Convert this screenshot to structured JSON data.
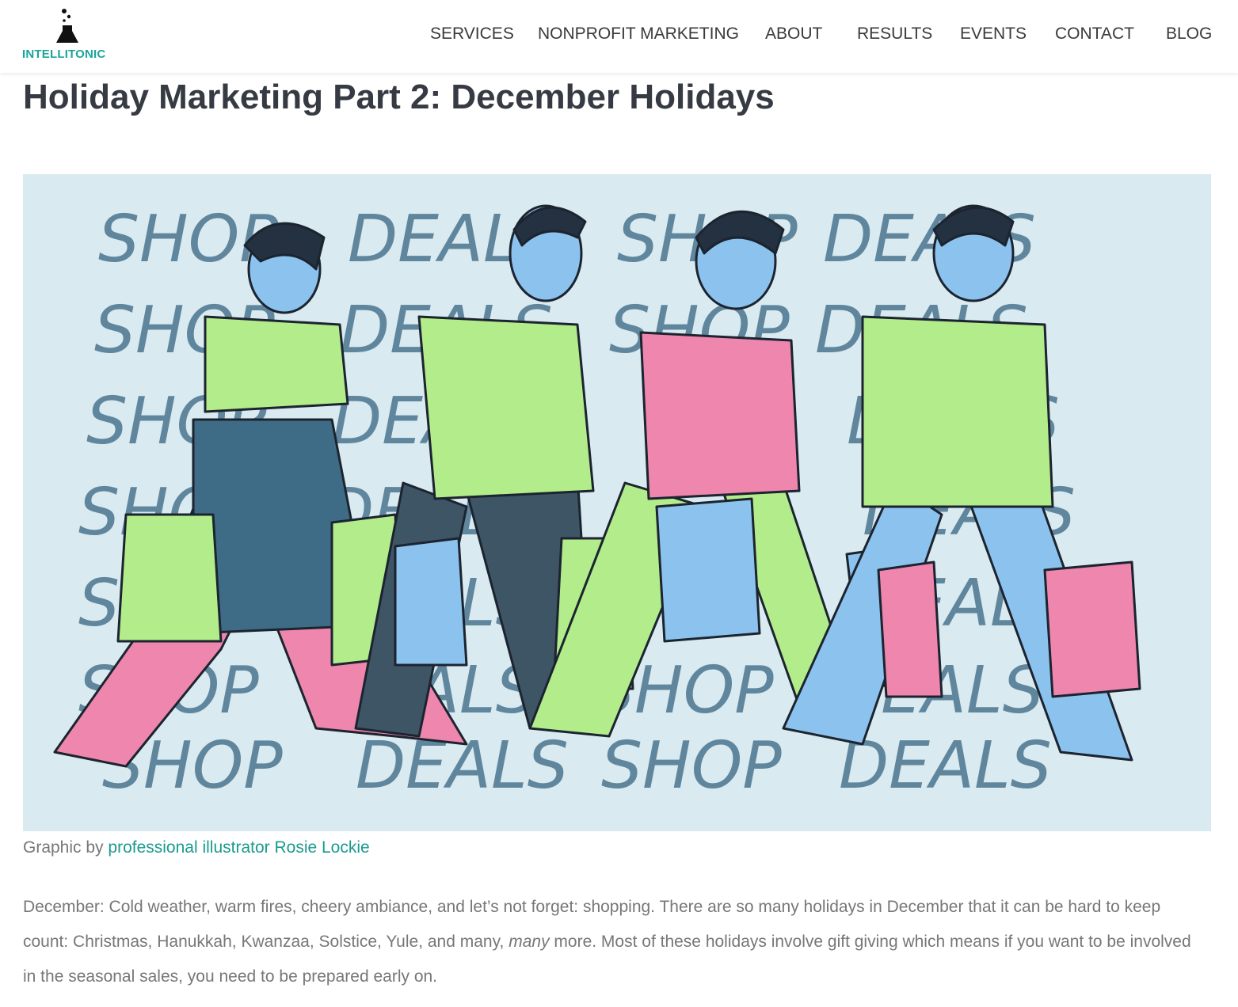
{
  "header": {
    "logo_text": "INTELLITONIC",
    "nav": [
      "SERVICES",
      "NONPROFIT MARKETING",
      "ABOUT",
      "RESULTS",
      "EVENTS",
      "CONTACT",
      "BLOG"
    ]
  },
  "post": {
    "title": "Holiday Marketing Part 2: December Holidays",
    "hero_words": [
      "SHOP",
      "DEALS"
    ],
    "caption_prefix": "Graphic by ",
    "caption_link": "professional illustrator Rosie Lockie",
    "body_part1": "December: Cold weather, warm fires, cheery ambiance, and let’s not forget: shopping. There are so many holidays in December that it can be hard to keep count: Christmas, Hanukkah, Kwanzaa, Solstice, Yule, and many, ",
    "body_emphasis": "many",
    "body_part2": " more. Most of these holidays involve gift giving which means if you want to be involved in the seasonal sales, you need to be prepared early on."
  },
  "colors": {
    "brand": "#1aa59a",
    "link": "#1a9b8f",
    "title": "#363a43",
    "hero_bg": "#d9eaf0",
    "lime": "#b3ec8a",
    "pink": "#ee86ad",
    "skin": "#8cc3ee"
  }
}
